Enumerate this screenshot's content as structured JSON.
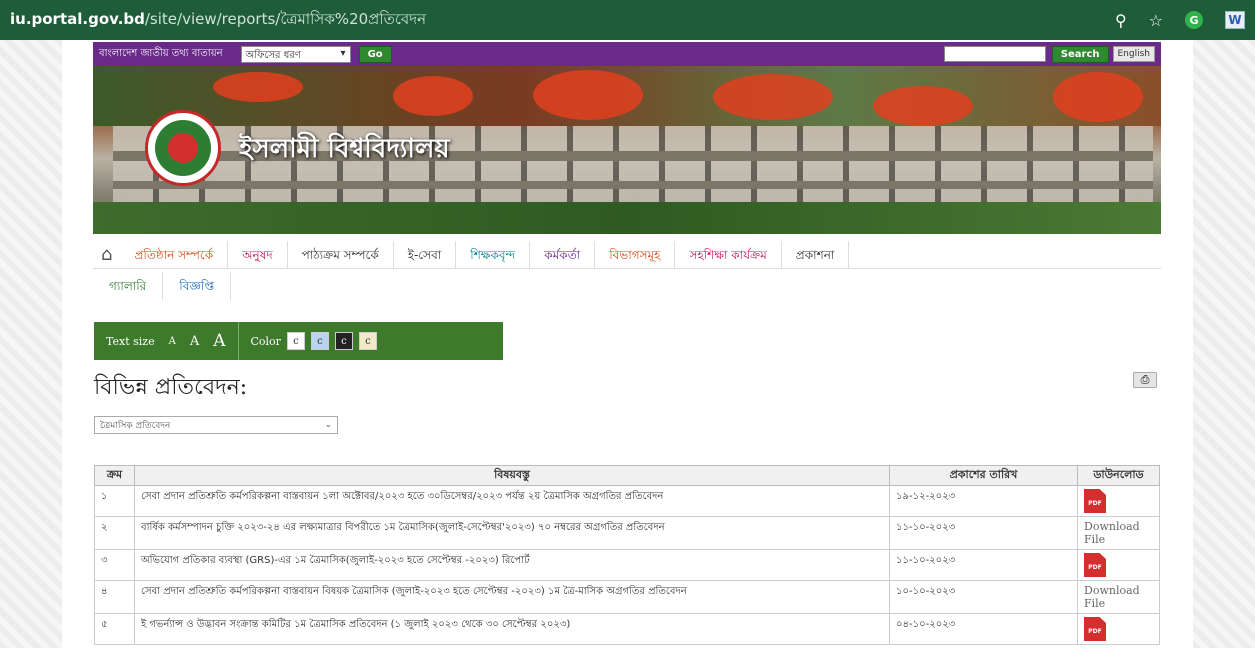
{
  "browser": {
    "url_domain": "iu.portal.gov.bd",
    "url_path": "/site/view/reports/ত্রৈমাসিক%20প্রতিবেদন"
  },
  "topbar": {
    "site_name": "বাংলাদেশ জাতীয় তথ্য বাতায়ন",
    "office_select": "অফিসের ধরণ",
    "go_label": "Go",
    "search_label": "Search",
    "english_label": "English"
  },
  "banner": {
    "title": "ইসলামী বিশ্ববিদ্যালয়"
  },
  "nav": {
    "items": [
      {
        "label": "প্রতিষ্ঠান সম্পর্কে",
        "color": "#d9480f"
      },
      {
        "label": "অনুষদ",
        "color": "#c2185b"
      },
      {
        "label": "পাঠ্যক্রম সম্পর্কে",
        "color": "#333333"
      },
      {
        "label": "ই-সেবা",
        "color": "#333333"
      },
      {
        "label": "শিক্ষকবৃন্দ",
        "color": "#00838f"
      },
      {
        "label": "কর্মকর্তা",
        "color": "#6a1b9a"
      },
      {
        "label": "বিভাগসমূহ",
        "color": "#d9480f"
      },
      {
        "label": "সহশিক্ষা কার্যক্রম",
        "color": "#c2185b"
      },
      {
        "label": "প্রকাশনা",
        "color": "#333333"
      }
    ],
    "row2": [
      {
        "label": "গ্যালারি",
        "color": "#2e7d32"
      },
      {
        "label": "বিজ্ঞপ্তি",
        "color": "#1565c0"
      }
    ]
  },
  "access": {
    "text_size_label": "Text size",
    "a_small": "A",
    "a_medium": "A",
    "a_large": "A",
    "color_label": "Color",
    "colors": [
      {
        "label": "c",
        "bg": "#ffffff",
        "fg": "#333333"
      },
      {
        "label": "c",
        "bg": "#b9d4f0",
        "fg": "#333333"
      },
      {
        "label": "c",
        "bg": "#222222",
        "fg": "#ffffff"
      },
      {
        "label": "c",
        "bg": "#f3e9c6",
        "fg": "#333333"
      }
    ]
  },
  "page": {
    "heading": "বিভিন্ন প্রতিবেদন:",
    "report_select": "ত্রৈমাসিক প্রতিবেদন"
  },
  "table": {
    "headers": {
      "serial": "ক্রম",
      "subject": "বিষয়বস্তু",
      "date": "প্রকাশের তারিখ",
      "download": "ডাউনলোড"
    },
    "rows": [
      {
        "serial": "১",
        "subject": "সেবা প্রদান প্রতিশ্রুতি কর্মপরিকল্পনা বাস্তবায়ন ১লা অক্টোবর/২০২৩ হতে ৩০ডিসেম্বর/২০২৩ পর্যন্ত ২য় ত্রৈমাসিক অগ্রগতির প্রতিবেদন",
        "date": "১৯-১২-২০২৩",
        "download_type": "pdf",
        "download_text": "PDF"
      },
      {
        "serial": "২",
        "subject": "বার্ষিক কর্মসম্পাদন চুক্তি ২০২৩-২৪ এর লক্ষ্যমাত্রার বিপরীতে ১ম ত্রৈমাসিক(জুলাই-সেপ্টেম্বর'২০২৩) ৭০ নম্বরের অগ্রগতির প্রতিবেদন",
        "date": "১১-১০-২০২৩",
        "download_type": "text",
        "download_text": "Download File"
      },
      {
        "serial": "৩",
        "subject": "অভিযোগ প্রতিকার ব্যবস্থা (GRS)-এর ১ম ত্রৈমাসিক(জুলাই-২০২৩ হতে সেপ্টেম্বর -২০২৩) রিপোর্ট",
        "date": "১১-১০-২০২৩",
        "download_type": "pdf",
        "download_text": "PDF"
      },
      {
        "serial": "৪",
        "subject": "সেবা প্রদান প্রতিশ্রুতি কর্মপরিকল্পনা বাস্তবায়ন বিষয়ক ত্রৈমাসিক (জুলাই-২০২৩ হতে সেপ্টেম্বর -২০২৩) ১ম ত্রৈ-মাসিক অগ্রগতির প্রতিবেদন",
        "date": "১০-১০-২০২৩",
        "download_type": "text",
        "download_text": "Download File"
      },
      {
        "serial": "৫",
        "subject": "ই গভর্ন্যান্স ও উদ্ভাবন সংক্রান্ত কমিটির ১ম ত্রৈমাসিক প্রতিবেদন (১ জুলাই ২০২৩ থেকে ৩০ সেপ্টেম্বর ২০২৩)",
        "date": "০৪-১০-২০২৩",
        "download_type": "pdf",
        "download_text": "PDF"
      }
    ]
  }
}
